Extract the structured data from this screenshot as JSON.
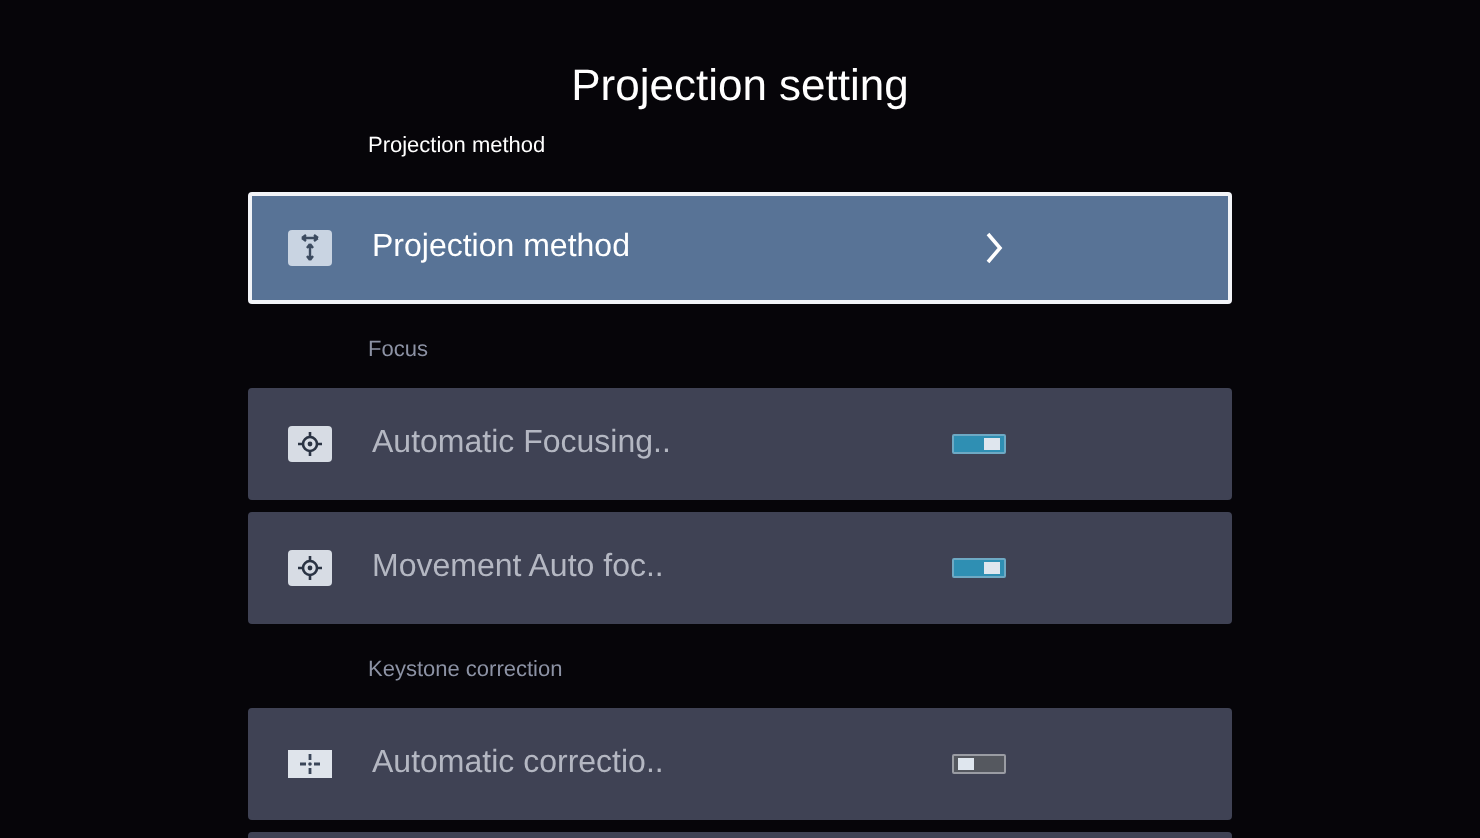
{
  "title": "Projection setting",
  "sections": [
    {
      "label": "Projection method",
      "items": [
        {
          "kind": "link",
          "label": "Projection method",
          "selected": true
        }
      ]
    },
    {
      "label": "Focus",
      "items": [
        {
          "kind": "toggle",
          "label": "Automatic Focusing..",
          "on": true,
          "selected": false
        },
        {
          "kind": "toggle",
          "label": "Movement Auto foc..",
          "on": true,
          "selected": false
        }
      ]
    },
    {
      "label": "Keystone correction",
      "items": [
        {
          "kind": "toggle",
          "label": "Automatic correctio..",
          "on": false,
          "selected": false
        },
        {
          "kind": "cut_off",
          "selected": false
        }
      ]
    }
  ]
}
